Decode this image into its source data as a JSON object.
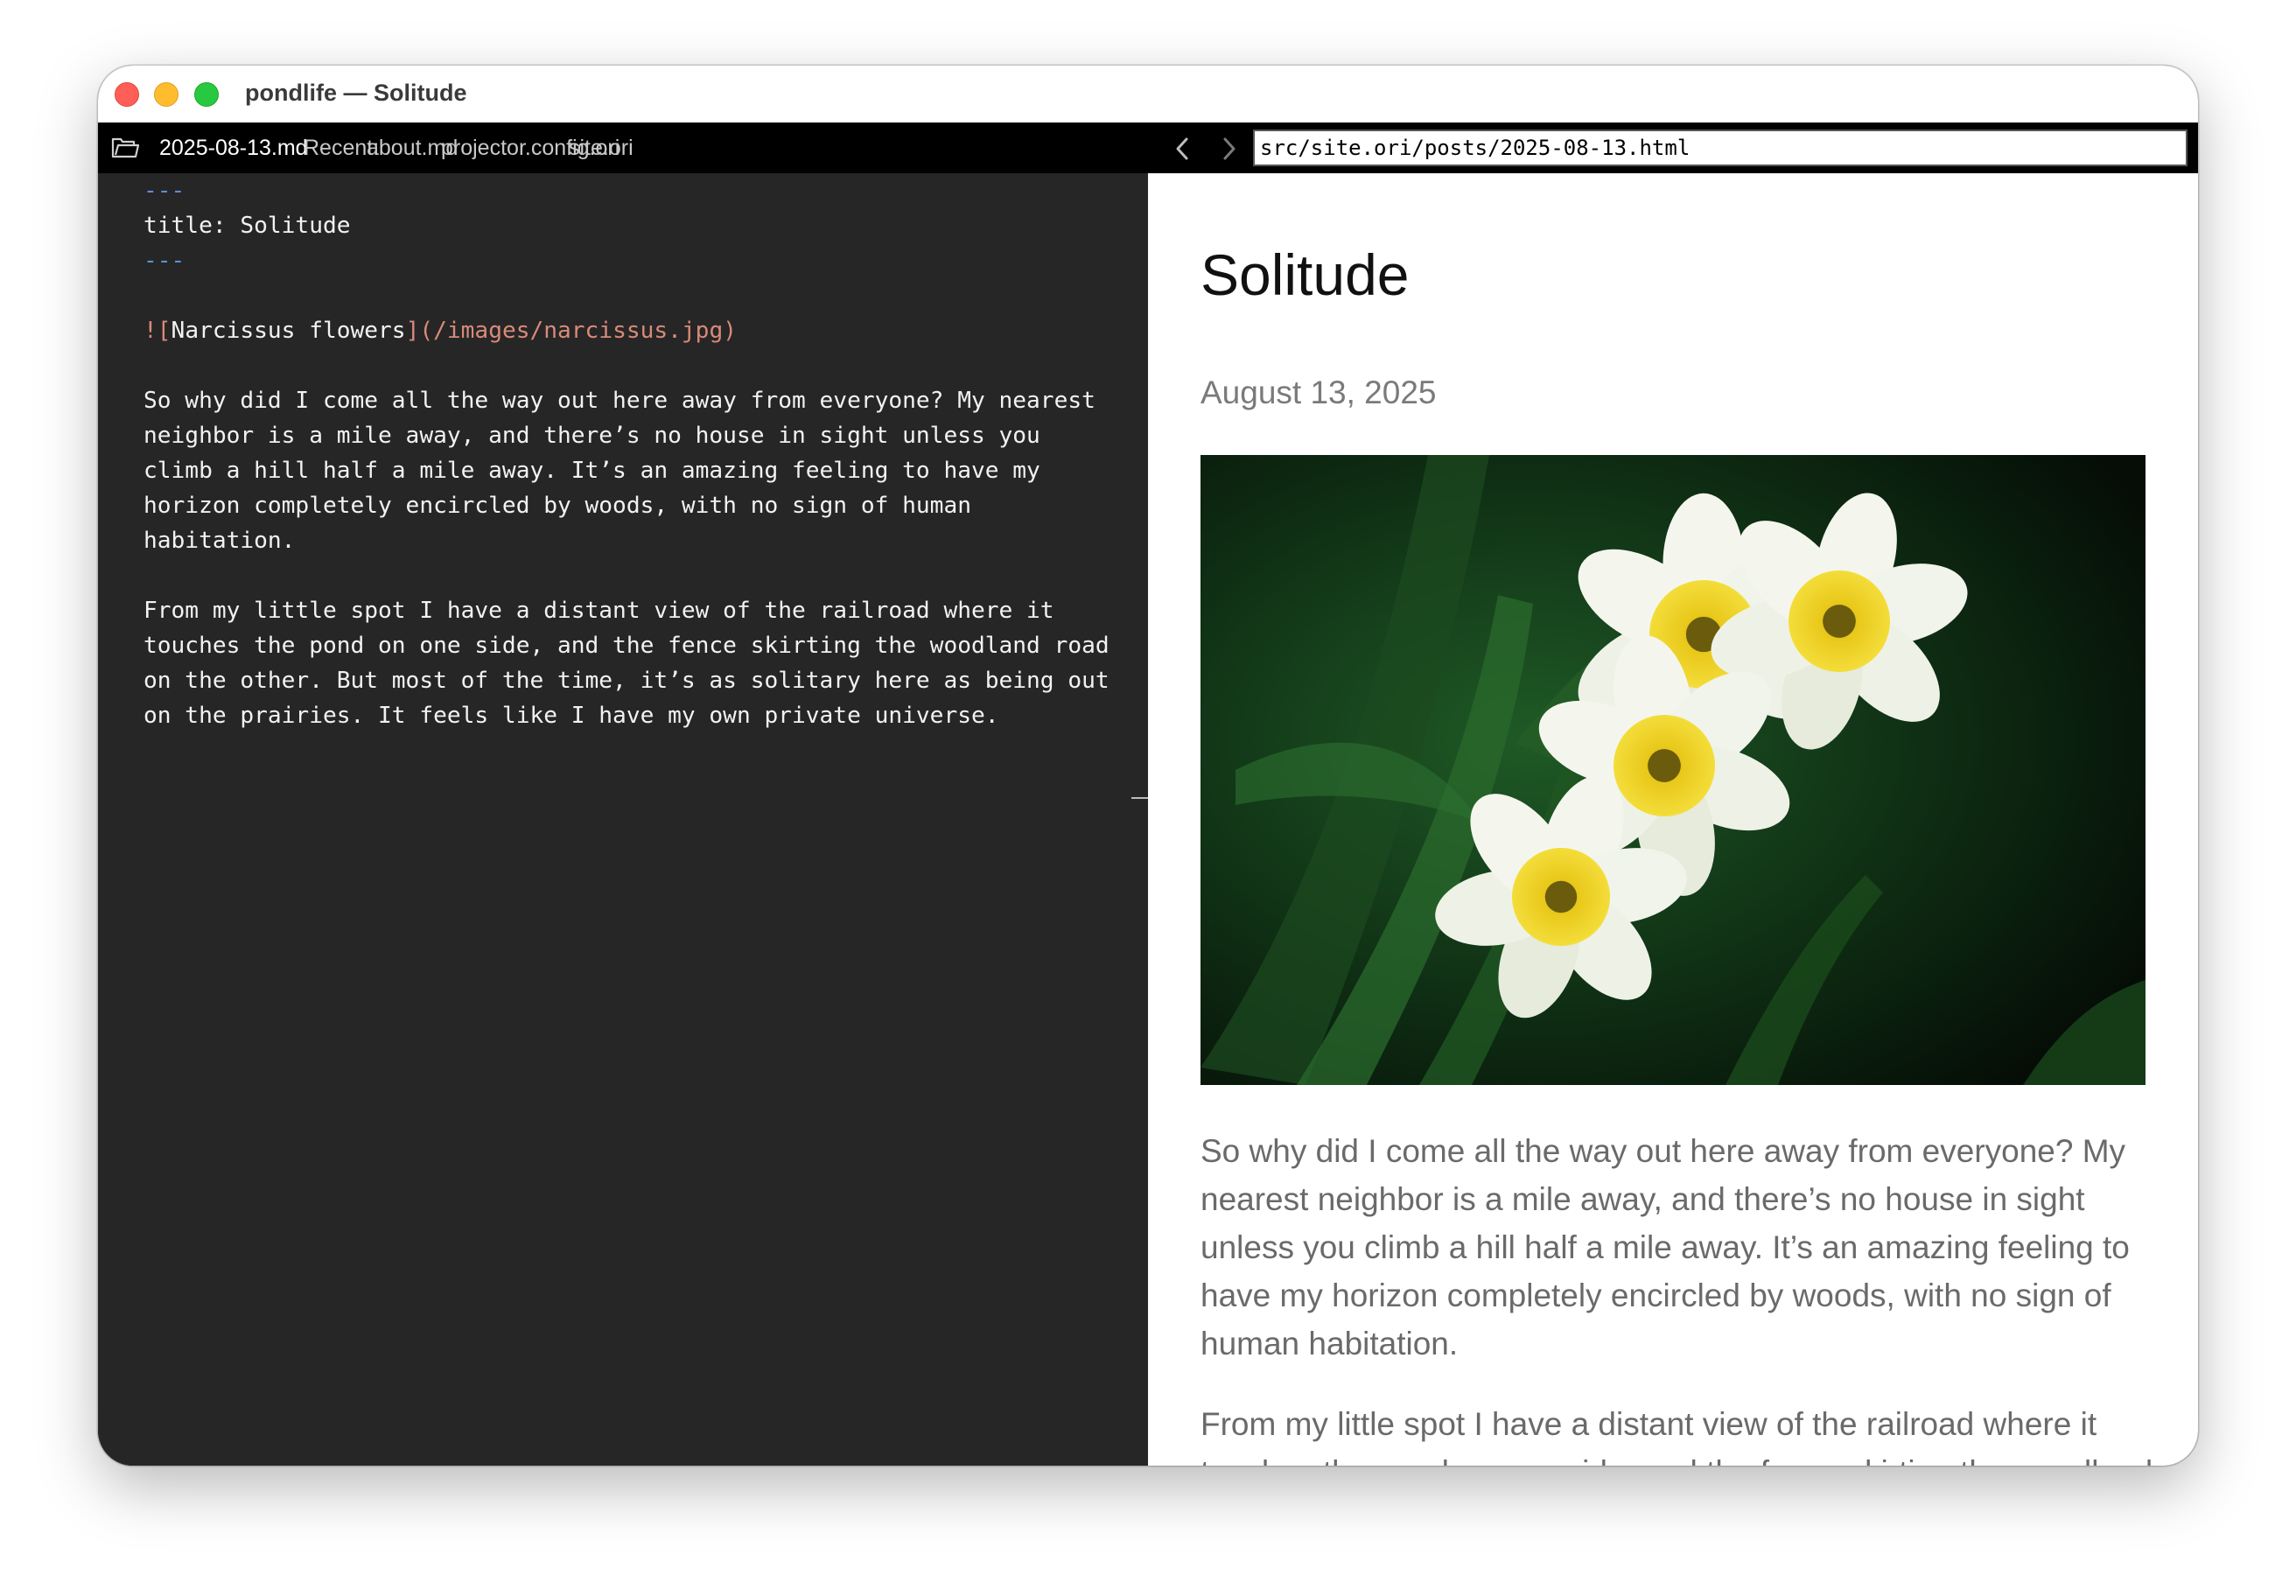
{
  "window": {
    "title": "pondlife — Solitude"
  },
  "toolbar": {
    "current_file": "2025-08-13.md",
    "recent_label": "Recent:",
    "recent_files": [
      "about.md",
      "projector.config.ori",
      "site.ori"
    ],
    "url": "src/site.ori/posts/2025-08-13.html"
  },
  "editor": {
    "frontmatter_marker": "---",
    "frontmatter_line": "title: Solitude",
    "image_alt": "Narcissus flowers",
    "image_url": "(/images/narcissus.jpg)",
    "paragraph1_lines": [
      "So why did I come all the way out here away from everyone? My nearest",
      "neighbor is a mile away, and there’s no house in sight unless you",
      "climb a hill half a mile away. It’s an amazing feeling to have my",
      "horizon completely encircled by woods, with no sign of human",
      "habitation."
    ],
    "paragraph2_lines": [
      "From my little spot I have a distant view of the railroad where it",
      "touches the pond on one side, and the fence skirting the woodland road",
      "on the other. But most of the time, it’s as solitary here as being out",
      "on the prairies. It feels like I have my own private universe."
    ]
  },
  "preview": {
    "title": "Solitude",
    "date": "August 13, 2025",
    "paragraphs": [
      "So why did I come all the way out here away from everyone? My nearest neighbor is a mile away, and there’s no house in sight unless you climb a hill half a mile away. It’s an amazing feeling to have my horizon completely encircled by woods, with no sign of human habitation.",
      "From my little spot I have a distant view of the railroad where it touches the pond on one side, and the fence skirting the woodland road on the other. But most of the time, it’s as solitary here as being out on the prairies. It feels like I have my own private universe."
    ]
  },
  "colors": {
    "editor_bg": "#262626",
    "toolbar_bg": "#000000",
    "frontmatter": "#5b8fd8",
    "markdown_link": "#d98a7a",
    "preview_text": "#6a6a6a"
  }
}
